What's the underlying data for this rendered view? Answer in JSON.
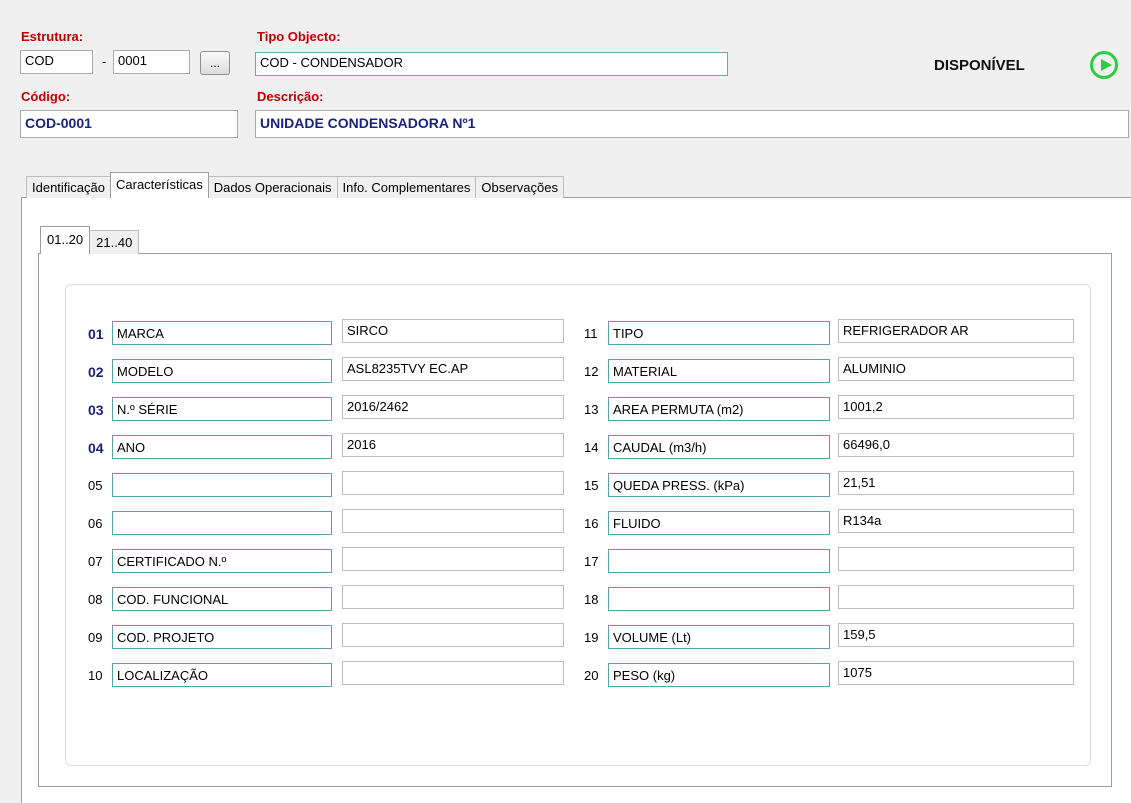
{
  "header": {
    "estrutura_label": "Estrutura:",
    "estrutura_code": "COD",
    "estrutura_sep": "-",
    "estrutura_num": "0001",
    "browse_label": "...",
    "tipo_label": "Tipo Objecto:",
    "tipo_value": "COD - CONDENSADOR",
    "codigo_label": "Código:",
    "codigo_value": "COD-0001",
    "descricao_label": "Descrição:",
    "descricao_value": "UNIDADE CONDENSADORA Nº1",
    "status": "DISPONÍVEL",
    "status_icon": "play-circle-icon",
    "status_color": "#2ecc40"
  },
  "tabs": [
    "Identificação",
    "Características",
    "Dados Operacionais",
    "Info. Complementares",
    "Observações"
  ],
  "subtabs": [
    "01..20",
    "21..40"
  ],
  "left_rows": [
    {
      "num": "01",
      "name": "MARCA",
      "value": "SIRCO"
    },
    {
      "num": "02",
      "name": "MODELO",
      "value": "ASL8235TVY EC.AP"
    },
    {
      "num": "03",
      "name": "N.º SÉRIE",
      "value": "2016/2462"
    },
    {
      "num": "04",
      "name": "ANO",
      "value": "2016"
    },
    {
      "num": "05",
      "name": "",
      "value": ""
    },
    {
      "num": "06",
      "name": "",
      "value": ""
    },
    {
      "num": "07",
      "name": "CERTIFICADO N.º",
      "value": ""
    },
    {
      "num": "08",
      "name": "COD. FUNCIONAL",
      "value": ""
    },
    {
      "num": "09",
      "name": "COD. PROJETO",
      "value": ""
    },
    {
      "num": "10",
      "name": "LOCALIZAÇÃO",
      "value": ""
    }
  ],
  "right_rows": [
    {
      "num": "11",
      "name": "TIPO",
      "value": "REFRIGERADOR AR"
    },
    {
      "num": "12",
      "name": "MATERIAL",
      "value": "ALUMINIO"
    },
    {
      "num": "13",
      "name": "AREA PERMUTA (m2)",
      "value": "1001,2"
    },
    {
      "num": "14",
      "name": "CAUDAL (m3/h)",
      "value": "66496,0"
    },
    {
      "num": "15",
      "name": "QUEDA PRESS. (kPa)",
      "value": "21,51"
    },
    {
      "num": "16",
      "name": "FLUIDO",
      "value": "R134a"
    },
    {
      "num": "17",
      "name": "",
      "value": ""
    },
    {
      "num": "18",
      "name": "",
      "value": ""
    },
    {
      "num": "19",
      "name": "VOLUME (Lt)",
      "value": "159,5"
    },
    {
      "num": "20",
      "name": "PESO (kg)",
      "value": "1075"
    }
  ]
}
